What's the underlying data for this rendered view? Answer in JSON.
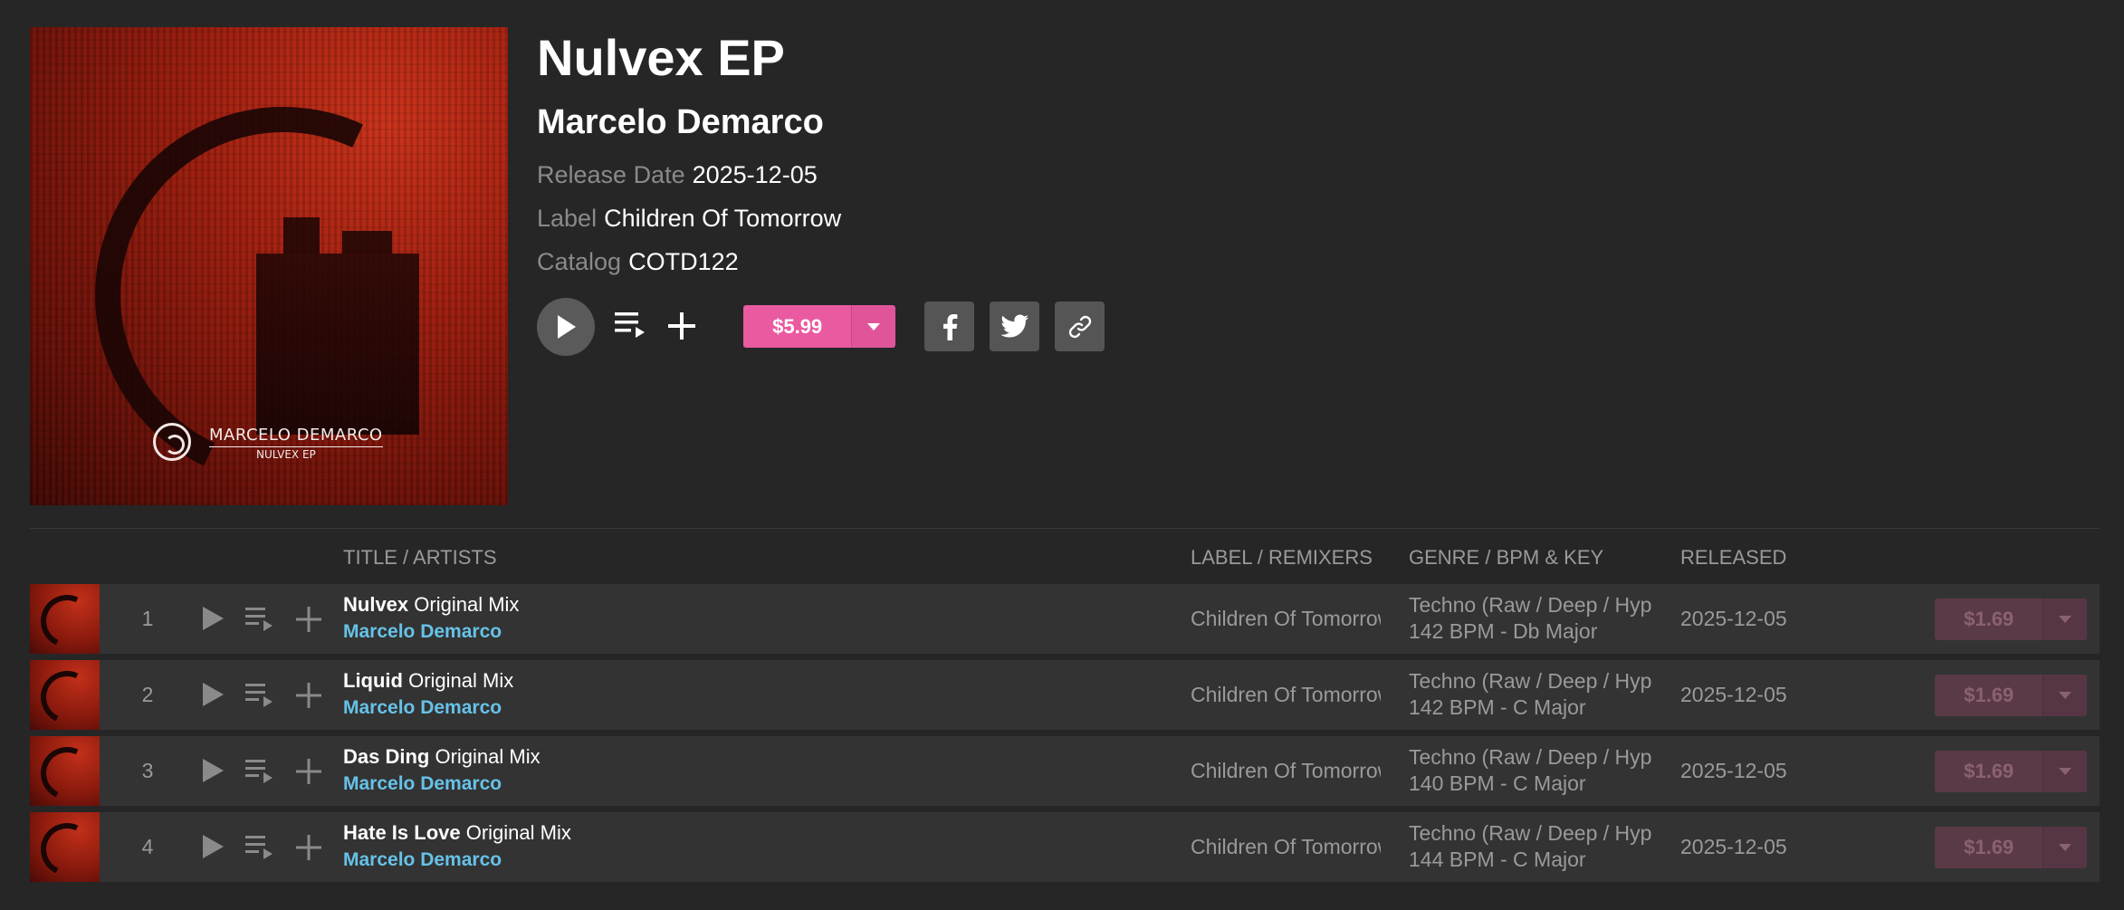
{
  "release": {
    "title": "Nulvex EP",
    "artist": "Marcelo Demarco",
    "release_date_label": "Release Date",
    "release_date": "2025-12-05",
    "label_label": "Label",
    "label": "Children Of Tomorrow",
    "catalog_label": "Catalog",
    "catalog": "COTD122",
    "price": "$5.99",
    "cover_artist": "MARCELO DEMARCO",
    "cover_title": "NULVEX EP"
  },
  "icons": {
    "play": "play-icon",
    "queue": "add-to-queue-icon",
    "add": "plus-icon",
    "dropdown": "caret-down-icon",
    "facebook": "facebook-icon",
    "twitter": "twitter-icon",
    "link": "link-icon"
  },
  "colors": {
    "background": "#262626",
    "row": "#333333",
    "accent": "#ea5aa0",
    "artist_link": "#66c2e8"
  },
  "table": {
    "headers": {
      "title": "TITLE / ARTISTS",
      "label": "LABEL / REMIXERS",
      "genre": "GENRE / BPM & KEY",
      "released": "RELEASED"
    },
    "tracks": [
      {
        "number": "1",
        "title": "Nulvex",
        "mix": "Original Mix",
        "artist": "Marcelo Demarco",
        "label": "Children Of Tomorrow",
        "genre": "Techno (Raw / Deep / Hypnotic)",
        "bpm_key": "142 BPM - Db Major",
        "released": "2025-12-05",
        "price": "$1.69"
      },
      {
        "number": "2",
        "title": "Liquid",
        "mix": "Original Mix",
        "artist": "Marcelo Demarco",
        "label": "Children Of Tomorrow",
        "genre": "Techno (Raw / Deep / Hypnotic)",
        "bpm_key": "142 BPM - C Major",
        "released": "2025-12-05",
        "price": "$1.69"
      },
      {
        "number": "3",
        "title": "Das Ding",
        "mix": "Original Mix",
        "artist": "Marcelo Demarco",
        "label": "Children Of Tomorrow",
        "genre": "Techno (Raw / Deep / Hypnotic)",
        "bpm_key": "140 BPM - C Major",
        "released": "2025-12-05",
        "price": "$1.69"
      },
      {
        "number": "4",
        "title": "Hate Is Love",
        "mix": "Original Mix",
        "artist": "Marcelo Demarco",
        "label": "Children Of Tomorrow",
        "genre": "Techno (Raw / Deep / Hypnotic)",
        "bpm_key": "144 BPM - C Major",
        "released": "2025-12-05",
        "price": "$1.69"
      }
    ]
  }
}
